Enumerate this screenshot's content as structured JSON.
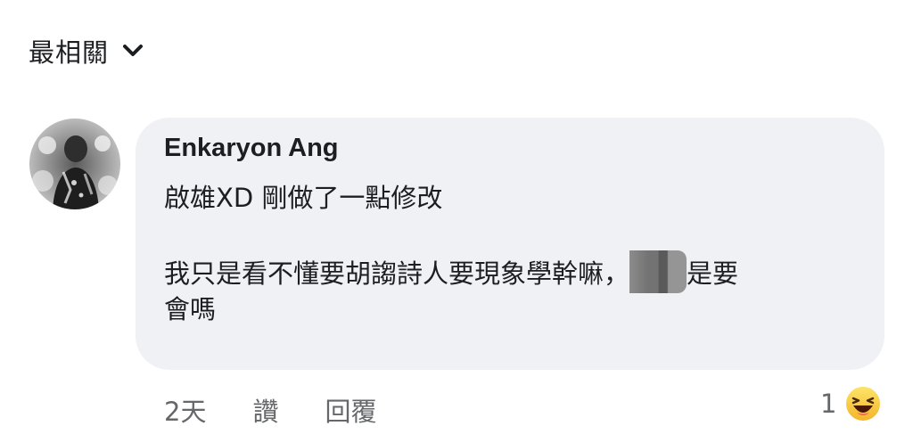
{
  "sort": {
    "label": "最相關",
    "icon": "chevron-down-icon"
  },
  "comment": {
    "author": "Enkaryon Ang",
    "line1": "啟雄XD 剛做了一點修改",
    "line2_before": "我只是看不懂要胡謅詩人要現象學幹嘛，",
    "line2_after": "是要",
    "line3": "會嗎",
    "avatar_icon": "avatar-photo"
  },
  "actions": {
    "time": "2天",
    "like_label": "讚",
    "reply_label": "回覆"
  },
  "reactions": {
    "count": "1",
    "icon": "haha-emoji-icon"
  },
  "colors": {
    "bubble_bg": "#eff1f5",
    "text": "#1c1e21",
    "secondary_text": "#65676b"
  }
}
